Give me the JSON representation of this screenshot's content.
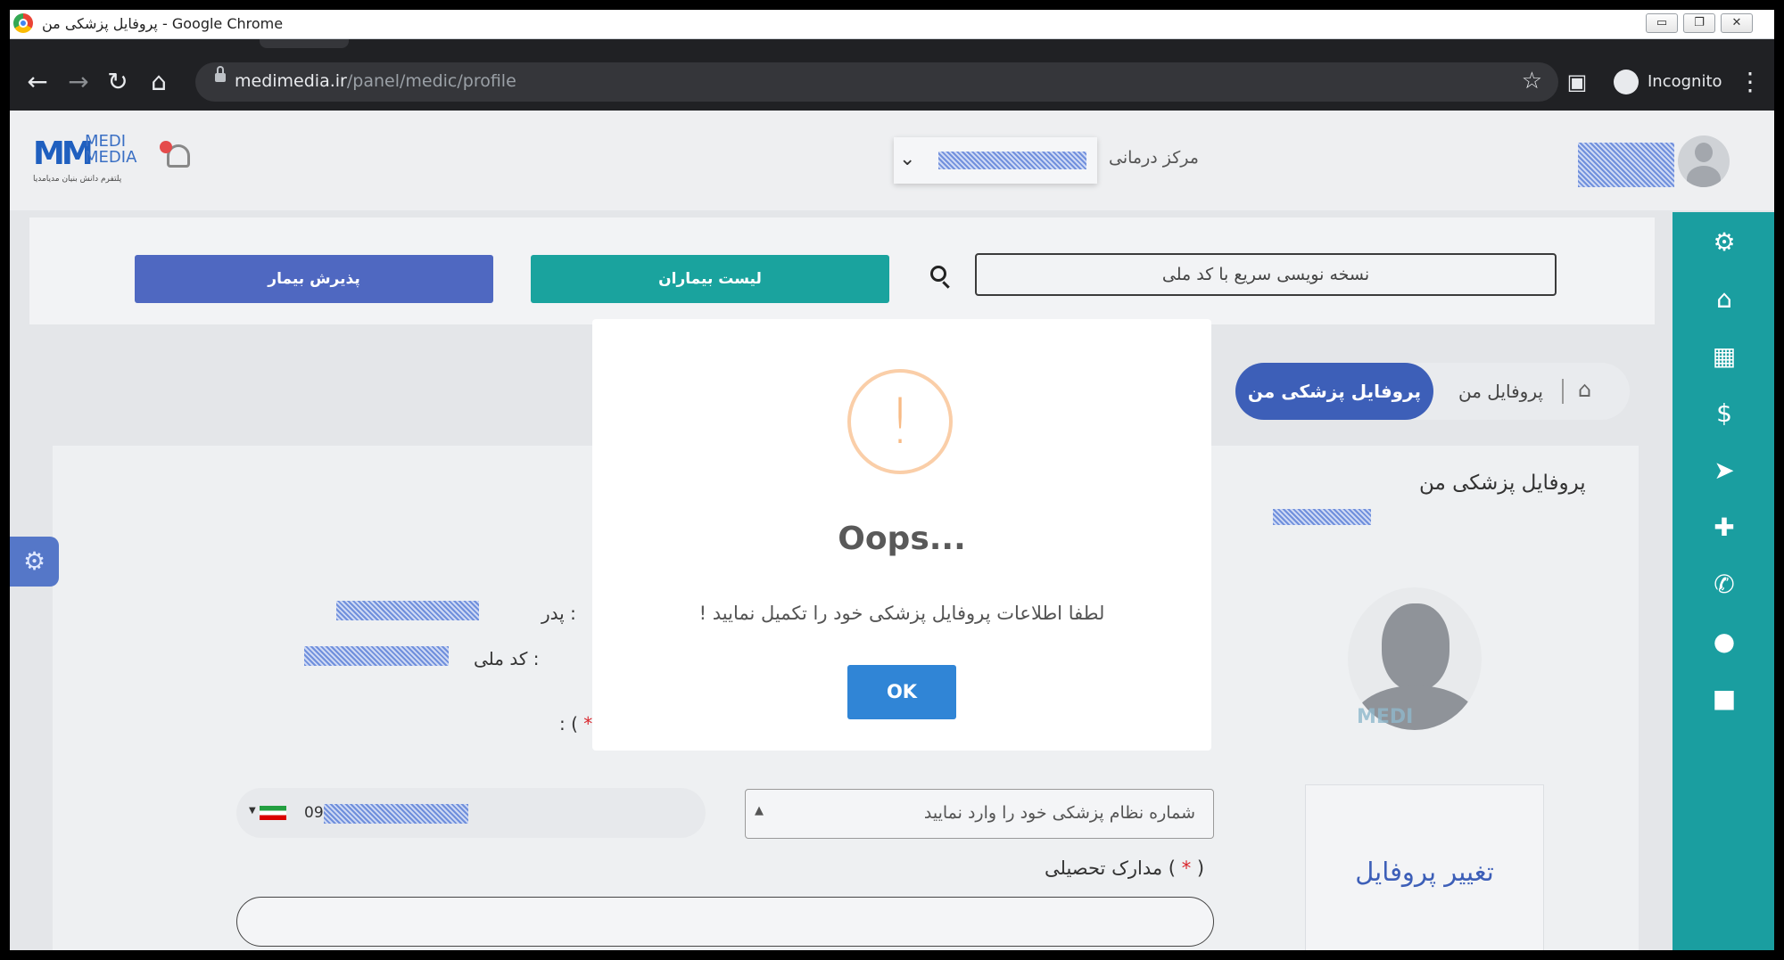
{
  "window": {
    "title": "پروفایل پزشکی من - Google Chrome",
    "minimize": "▭",
    "restore": "❐",
    "close": "✕"
  },
  "browser": {
    "url_host": "medimedia.ir",
    "url_path": "/panel/medic/profile",
    "incognito_label": "Incognito",
    "back": "←",
    "forward": "→",
    "reload": "↻",
    "home": "⌂",
    "star": "☆",
    "sidepanel": "▣",
    "menu": "⋮"
  },
  "header": {
    "brand_line1": "MEDI",
    "brand_line2": "MEDIA",
    "brand_tagline": "پلتفرم دانش بنیان مدیامدیا",
    "center_label": "مرکز درمانی",
    "center_chevron": "⌄"
  },
  "toolbox": {
    "admit_button": "پذیرش بیمار",
    "patients_button": "لیست بیماران",
    "quick_prescription_placeholder": "نسخه نویسی سریع با کد ملی"
  },
  "breadcrumb": {
    "active": "پروفایل پزشکی من",
    "item": "پروفایل من",
    "home_icon": "⌂"
  },
  "profile": {
    "title": "پروفایل پزشکی من",
    "father_label": "پدر :",
    "national_code_label": "کد ملی :",
    "required_label": ": (",
    "required_star": "*",
    "medic_number_placeholder": "شماره نظام پزشکی خود را وارد نمایید",
    "select_arrow": "▲",
    "phone_prefix": "09",
    "phone_arrow": "▼",
    "education_label": "مدارک تحصیلی (",
    "education_star": "*",
    "education_close": ")",
    "change_profile": "تغییر پروفایل",
    "avatar_watermark": "MEDI"
  },
  "sidebar": {
    "icons": [
      "⚙",
      "⌂",
      "▦",
      "$",
      "➤",
      "✚",
      "✆",
      "●",
      "■"
    ]
  },
  "float_settings": "⚙",
  "modal": {
    "icon": "!",
    "title": "Oops...",
    "message": "لطفا اطلاعات پروفایل پزشکی خود را تکمیل نمایید !",
    "ok_button": "OK",
    "accent": "#3085d6",
    "warning_color": "#f8bb86"
  },
  "colors": {
    "sidebar": "#1a9ea0",
    "admit_button": "#4f68c1",
    "patients_button": "#1aa39e",
    "breadcrumb_active": "#3d5fb8"
  }
}
